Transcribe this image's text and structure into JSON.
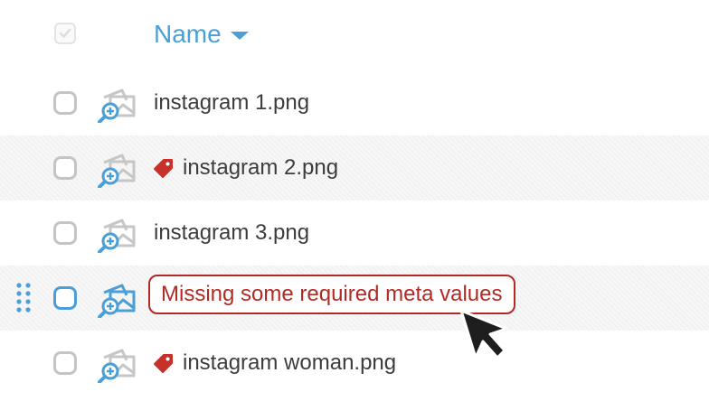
{
  "header": {
    "select_all_checked": true,
    "name_column_label": "Name",
    "sort_direction": "descending"
  },
  "colors": {
    "accent": "#4a9fd6",
    "error": "#b12b24",
    "tag": "#c8302a",
    "text": "#3c3c3c"
  },
  "files": [
    {
      "name": "instagram 1.png",
      "tagged": false
    },
    {
      "name": "instagram 2.png",
      "tagged": true
    },
    {
      "name": "instagram 3.png",
      "tagged": false
    },
    {
      "name": "",
      "tooltip": "Missing some required meta values",
      "hovered": true
    },
    {
      "name": "instagram woman.png",
      "tagged": true
    }
  ],
  "icons": {
    "thumbnail": "image-zoom-icon",
    "tag": "tag-icon",
    "drag": "drag-handle-icon",
    "sort": "caret-down-icon"
  }
}
